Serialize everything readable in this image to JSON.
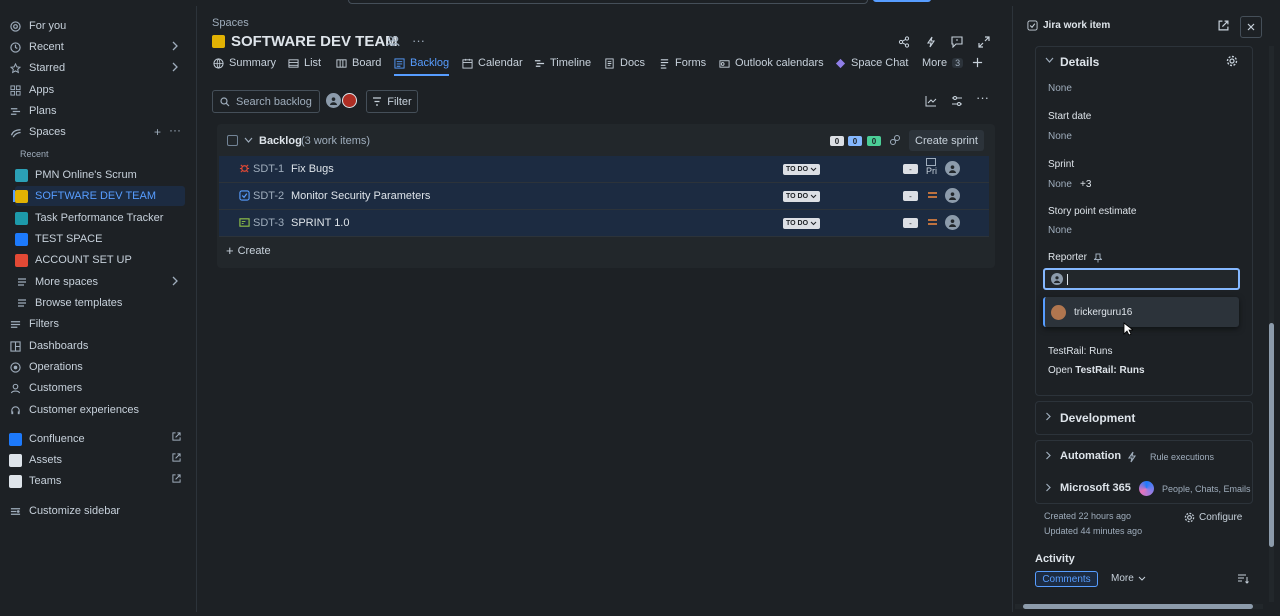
{
  "sidebar": {
    "items": [
      {
        "label": "For you",
        "icon": "target-icon"
      },
      {
        "label": "Recent",
        "icon": "clock-icon"
      },
      {
        "label": "Starred",
        "icon": "star-icon"
      },
      {
        "label": "Apps",
        "icon": "apps-icon"
      },
      {
        "label": "Plans",
        "icon": "plans-icon"
      },
      {
        "label": "Spaces",
        "icon": "spaces-icon"
      }
    ],
    "recent_label": "Recent",
    "spaces": [
      {
        "label": "PMN Online's Scrum",
        "color": "#2ba0b6"
      },
      {
        "label": "SOFTWARE DEV TEAM",
        "color": "#e2b203"
      },
      {
        "label": "Task Performance Tracker",
        "color": "#1d9aaa"
      },
      {
        "label": "TEST SPACE",
        "color": "#1d7afc"
      },
      {
        "label": "ACCOUNT SET UP",
        "color": "#e34935"
      }
    ],
    "more_spaces": "More spaces",
    "browse_templates": "Browse templates",
    "lower_items": [
      {
        "label": "Filters",
        "icon": "filter-icon"
      },
      {
        "label": "Dashboards",
        "icon": "dashboard-icon"
      },
      {
        "label": "Operations",
        "icon": "operations-icon"
      },
      {
        "label": "Customers",
        "icon": "person-icon"
      },
      {
        "label": "Customer experiences",
        "icon": "headset-icon"
      }
    ],
    "apps": [
      {
        "label": "Confluence",
        "color": "#1d7afc"
      },
      {
        "label": "Assets",
        "color": "#dee4ea"
      },
      {
        "label": "Teams",
        "color": "#dee4ea"
      }
    ],
    "customize": "Customize sidebar"
  },
  "header": {
    "breadcrumb": "Spaces",
    "title": "SOFTWARE DEV TEAM"
  },
  "tabs": [
    {
      "label": "Summary",
      "icon": "globe-icon"
    },
    {
      "label": "List",
      "icon": "list-icon"
    },
    {
      "label": "Board",
      "icon": "board-icon"
    },
    {
      "label": "Backlog",
      "icon": "backlog-icon",
      "active": true
    },
    {
      "label": "Calendar",
      "icon": "calendar-icon"
    },
    {
      "label": "Timeline",
      "icon": "timeline-icon"
    },
    {
      "label": "Docs",
      "icon": "docs-icon"
    },
    {
      "label": "Forms",
      "icon": "forms-icon"
    },
    {
      "label": "Outlook calendars",
      "icon": "outlook-icon"
    },
    {
      "label": "Space Chat",
      "icon": "chat-icon"
    }
  ],
  "more_tabs": {
    "label": "More",
    "count": "3"
  },
  "toolbar": {
    "search_placeholder": "Search backlog",
    "filter_label": "Filter"
  },
  "backlog": {
    "title": "Backlog",
    "count_label": "(3 work items)",
    "badges": [
      "0",
      "0",
      "0"
    ],
    "create_sprint": "Create sprint",
    "create_label": "Create",
    "rows": [
      {
        "key": "SDT-1",
        "summary": "Fix Bugs",
        "status": "TO DO",
        "type": "bug",
        "estimate": "-",
        "extra": "Pri"
      },
      {
        "key": "SDT-2",
        "summary": "Monitor Security Parameters",
        "status": "TO DO",
        "type": "task",
        "estimate": "-"
      },
      {
        "key": "SDT-3",
        "summary": "SPRINT 1.0",
        "status": "TO DO",
        "type": "story",
        "estimate": "-"
      }
    ]
  },
  "panel": {
    "header": "Jira work item",
    "details_title": "Details",
    "first_value": "None",
    "start_date_label": "Start date",
    "start_date_value": "None",
    "sprint_label": "Sprint",
    "sprint_value": "None",
    "sprint_extra": "+3",
    "story_points_label": "Story point estimate",
    "story_points_value": "None",
    "reporter_label": "Reporter",
    "reporter_option": "trickerguru16",
    "testrail_label": "TestRail: Runs",
    "testrail_open_prefix": "Open ",
    "testrail_open_link": "TestRail: Runs",
    "development": "Development",
    "automation": "Automation",
    "automation_sub": "Rule executions",
    "microsoft": "Microsoft 365",
    "microsoft_sub": "People, Chats, Emails",
    "created": "Created 22 hours ago",
    "updated": "Updated 44 minutes ago",
    "configure": "Configure",
    "activity": "Activity",
    "comments": "Comments",
    "more": "More"
  }
}
